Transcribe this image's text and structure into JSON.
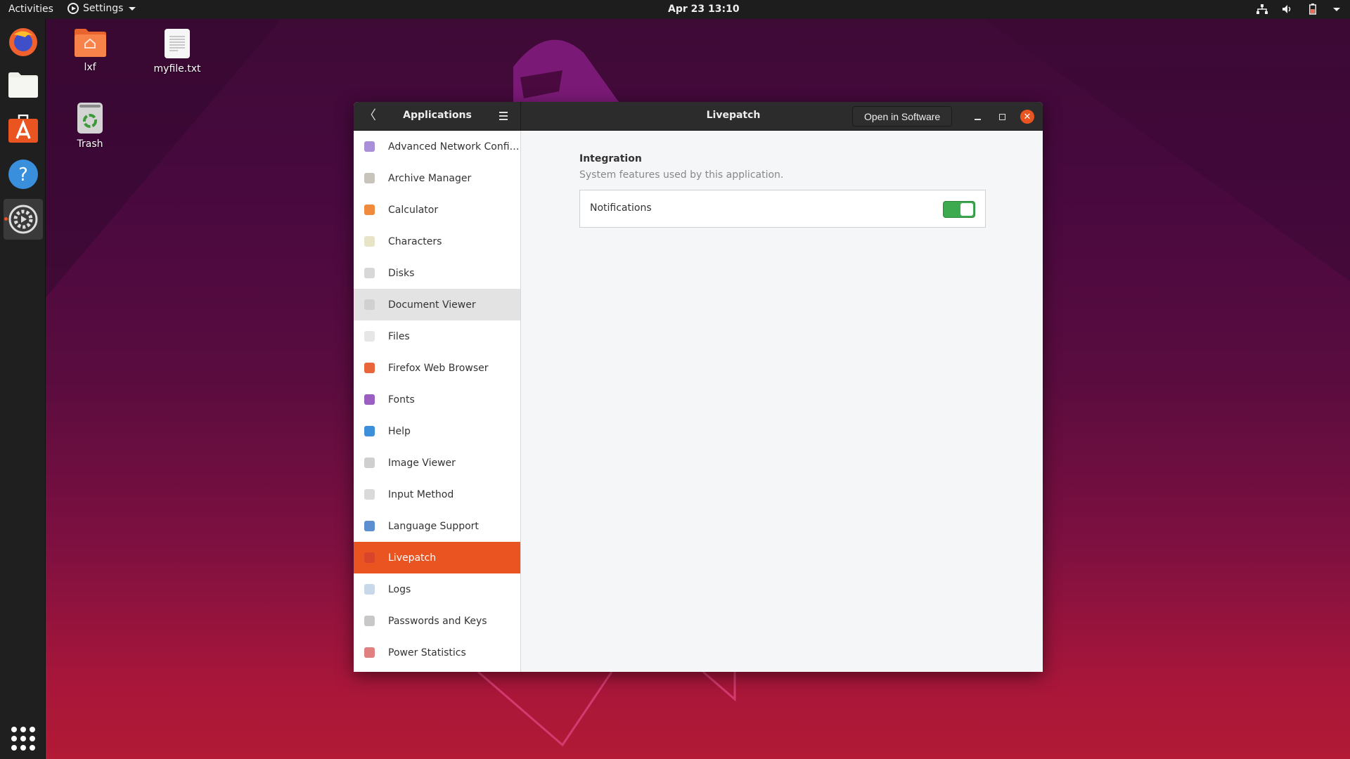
{
  "topbar": {
    "activities": "Activities",
    "app_menu": "Settings",
    "clock": "Apr 23  13:10",
    "tray": [
      "network-icon",
      "volume-icon",
      "battery-icon",
      "system-menu-caret-icon"
    ]
  },
  "dock": {
    "items": [
      {
        "name": "Firefox Web Browser",
        "icon": "firefox-icon"
      },
      {
        "name": "Files",
        "icon": "files-icon"
      },
      {
        "name": "Ubuntu Software",
        "icon": "software-icon"
      },
      {
        "name": "Help",
        "icon": "help-icon"
      },
      {
        "name": "Settings",
        "icon": "settings-icon",
        "active": true
      }
    ],
    "show_apps": "show-applications-icon"
  },
  "desktop": {
    "icons": [
      {
        "label": "lxf",
        "icon": "home-folder-icon"
      },
      {
        "label": "myfile.txt",
        "icon": "text-file-icon"
      },
      {
        "label": "Trash",
        "icon": "trash-icon"
      }
    ]
  },
  "window": {
    "sidebar_title": "Applications",
    "title": "Livepatch",
    "open_in_software": "Open in Software",
    "close_glyph": "✕",
    "back_glyph": "〈",
    "apps": [
      {
        "label": "Advanced Network Confi…",
        "color": "#a88fd8",
        "state": ""
      },
      {
        "label": "Archive Manager",
        "color": "#c8c4bc",
        "state": ""
      },
      {
        "label": "Calculator",
        "color": "#f08a3c",
        "state": ""
      },
      {
        "label": "Characters",
        "color": "#e8e4c8",
        "state": ""
      },
      {
        "label": "Disks",
        "color": "#d8d8d8",
        "state": ""
      },
      {
        "label": "Document Viewer",
        "color": "#d0d0d0",
        "state": "hover"
      },
      {
        "label": "Files",
        "color": "#e6e6e6",
        "state": ""
      },
      {
        "label": "Firefox Web Browser",
        "color": "#e8663a",
        "state": ""
      },
      {
        "label": "Fonts",
        "color": "#9a5fc0",
        "state": ""
      },
      {
        "label": "Help",
        "color": "#3c8fd8",
        "state": ""
      },
      {
        "label": "Image Viewer",
        "color": "#cfcfcf",
        "state": ""
      },
      {
        "label": "Input Method",
        "color": "#dadada",
        "state": ""
      },
      {
        "label": "Language Support",
        "color": "#5b8fd0",
        "state": ""
      },
      {
        "label": "Livepatch",
        "color": "#d8452a",
        "state": "selected"
      },
      {
        "label": "Logs",
        "color": "#c8d8e8",
        "state": ""
      },
      {
        "label": "Passwords and Keys",
        "color": "#c8c8c8",
        "state": ""
      },
      {
        "label": "Power Statistics",
        "color": "#e08080",
        "state": ""
      }
    ],
    "content": {
      "section_title": "Integration",
      "section_subtitle": "System features used by this application.",
      "rows": [
        {
          "label": "Notifications",
          "enabled": true
        }
      ]
    }
  },
  "colors": {
    "accent": "#e95420",
    "toggle_on": "#3eaa50",
    "headerbar": "#2c2c2c"
  }
}
